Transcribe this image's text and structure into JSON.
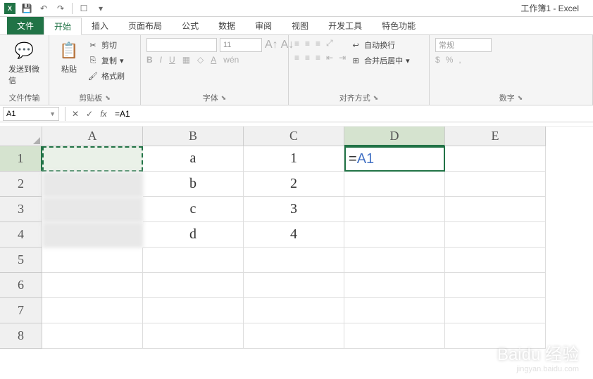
{
  "app": {
    "title": "工作簿1 - Excel"
  },
  "tabs": {
    "file": "文件",
    "items": [
      "开始",
      "插入",
      "页面布局",
      "公式",
      "数据",
      "审阅",
      "视图",
      "开发工具",
      "特色功能"
    ],
    "active": 0
  },
  "ribbon": {
    "wechat": {
      "label": "发送到微信"
    },
    "clipboard": {
      "paste": "粘贴",
      "cut": "剪切",
      "copy": "复制",
      "format_painter": "格式刷",
      "group": "剪贴板"
    },
    "font": {
      "size": "11",
      "group": "字体"
    },
    "align": {
      "wrap": "自动换行",
      "merge": "合并后居中",
      "group": "对齐方式"
    },
    "number": {
      "format": "常规",
      "group": "数字"
    },
    "transfer": "文件传输"
  },
  "formula_bar": {
    "name_box": "A1",
    "formula": "=A1"
  },
  "grid": {
    "columns": [
      "A",
      "B",
      "C",
      "D",
      "E"
    ],
    "rows": [
      "1",
      "2",
      "3",
      "4",
      "5",
      "6",
      "7",
      "8"
    ],
    "active_col": 3,
    "cells": {
      "B1": "a",
      "B2": "b",
      "B3": "c",
      "B4": "d",
      "C1": "1",
      "C2": "2",
      "C3": "3",
      "C4": "4",
      "D1_prefix": "=",
      "D1_ref": "A1"
    }
  },
  "watermark": {
    "main": "Baidu 经验",
    "sub": "jingyan.baidu.com"
  }
}
